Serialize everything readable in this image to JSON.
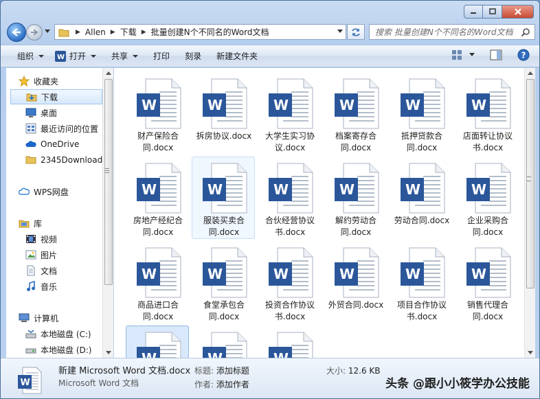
{
  "window": {
    "breadcrumb": [
      "Allen",
      "下载",
      "批量创建N个不同名的Word文档"
    ],
    "search_placeholder": "搜索 批量创建N个不同名的Word文档"
  },
  "toolbar": {
    "organize": "组织",
    "open": "打开",
    "share": "共享",
    "print": "打印",
    "burn": "刻录",
    "new_folder": "新建文件夹"
  },
  "nav": {
    "favorites": "收藏夹",
    "downloads": "下载",
    "desktop": "桌面",
    "recent": "最近访问的位置",
    "onedrive": "OneDrive",
    "downloads2345": "2345Downloads",
    "wps": "WPS网盘",
    "libraries": "库",
    "videos": "视频",
    "pictures": "图片",
    "documents": "文档",
    "music": "音乐",
    "computer": "计算机",
    "disk_c": "本地磁盘 (C:)",
    "disk_d": "本地磁盘 (D:)"
  },
  "files": [
    {
      "name": "财产保险合同.docx"
    },
    {
      "name": "拆房协议.docx"
    },
    {
      "name": "大学生实习协议.docx"
    },
    {
      "name": "档案寄存合同.docx"
    },
    {
      "name": "抵押贷款合同.docx"
    },
    {
      "name": "店面转让协议书.docx"
    },
    {
      "name": "房地产经纪合同.docx"
    },
    {
      "name": "服装买卖合同.docx"
    },
    {
      "name": "合伙经营协议书.docx"
    },
    {
      "name": "解约劳动合同.docx"
    },
    {
      "name": "劳动合同.docx"
    },
    {
      "name": "企业采购合同.docx"
    },
    {
      "name": "商品进口合同.docx"
    },
    {
      "name": "食堂承包合同.docx"
    },
    {
      "name": "投资合作协议书.docx"
    },
    {
      "name": "外贸合同.docx"
    },
    {
      "name": "项目合作协议书.docx"
    },
    {
      "name": "销售代理合同.docx"
    },
    {
      "name": ""
    },
    {
      "name": ""
    },
    {
      "name": ""
    }
  ],
  "details": {
    "file_name": "新建 Microsoft Word 文档.docx",
    "file_type": "Microsoft Word 文档",
    "title_key": "标题:",
    "title_value": "添加标题",
    "author_key": "作者:",
    "author_value": "添加作者",
    "size_key": "大小:",
    "size_value": "12.6 KB"
  },
  "watermark": "头条 @跟小小筱学办公技能",
  "colors": {
    "word_blue": "#2b579a",
    "selection": "#d9e9fb"
  }
}
